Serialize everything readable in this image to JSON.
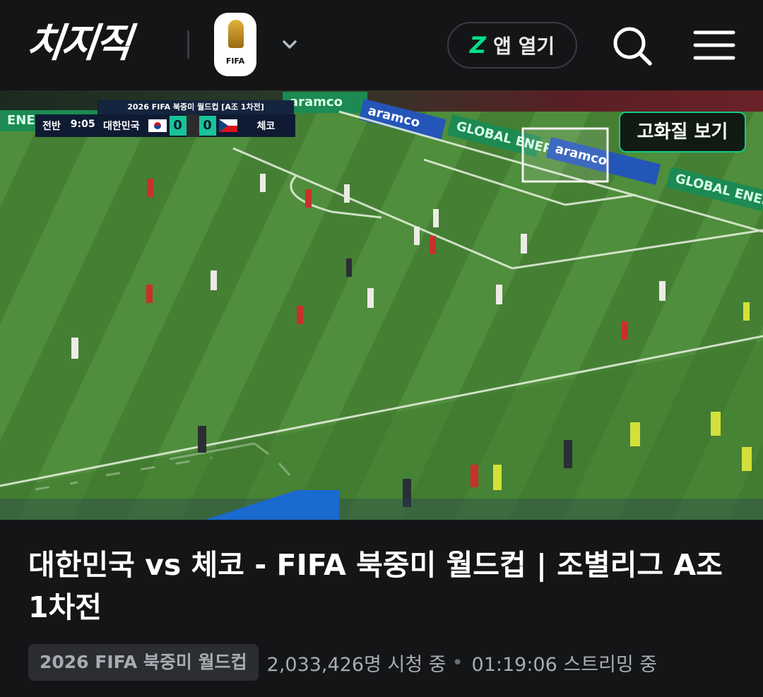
{
  "header": {
    "logo_text": "치지직",
    "badge_label": "FIFA",
    "app_button_icon": "chzzk-z-icon",
    "app_button_label": "앱 열기",
    "icons": {
      "search": "search-icon",
      "menu": "hamburger-menu-icon",
      "dropdown": "chevron-down-icon"
    }
  },
  "video": {
    "scorebug": {
      "title": "2026 FIFA 북중미 월드컵 [A조 1차전]",
      "period": "전반",
      "clock": "9:05",
      "home_team": "대한민국",
      "home_score": "0",
      "away_score": "0",
      "away_team": "체코"
    },
    "boards": [
      "aramco",
      "aramco",
      "GLOBAL ENERGY PARTNER",
      "aramco",
      "GLOBAL ENERGY"
    ],
    "left_board": "ENERGY",
    "hq_button_label": "고화질 보기"
  },
  "stream": {
    "title": "대한민국 vs 체코 - FIFA 북중미 월드컵 | 조별리그 A조 1차전",
    "category": "2026 FIFA 북중미 월드컵",
    "viewers": "2,033,426명 시청 중",
    "separator": "•",
    "uptime": "01:19:06 스트리밍 중"
  },
  "colors": {
    "background": "#141517",
    "accent": "#00e08a",
    "pitch": "#4f8e3c",
    "muted_text": "#a8abb2"
  }
}
